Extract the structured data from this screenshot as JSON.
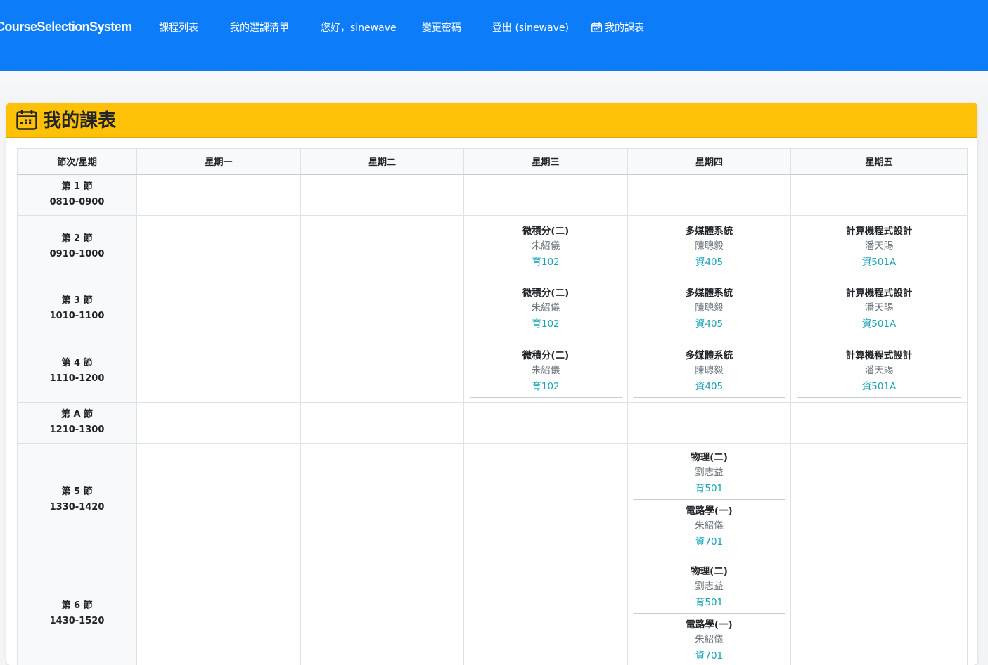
{
  "navbar": {
    "brand": "CourseSelectionSystem",
    "links": [
      "課程列表",
      "我的選課清單",
      "您好，sinewave",
      "變更密碼",
      "登出 (sinewave)",
      "我的課表"
    ]
  },
  "card": {
    "title": "我的課表"
  },
  "table": {
    "headers": [
      "節次/星期",
      "星期一",
      "星期二",
      "星期三",
      "星期四",
      "星期五"
    ],
    "rows": [
      {
        "period": "第 1 節",
        "time": "0810-0900"
      },
      {
        "period": "第 2 節",
        "time": "0910-1000"
      },
      {
        "period": "第 3 節",
        "time": "1010-1100"
      },
      {
        "period": "第 4 節",
        "time": "1110-1200"
      },
      {
        "period": "第 A 節",
        "time": "1210-1300"
      },
      {
        "period": "第 5 節",
        "time": "1330-1420"
      },
      {
        "period": "第 6 節",
        "time": "1430-1520"
      }
    ],
    "courses": {
      "calculus": {
        "name": "微積分(二)",
        "teacher": "朱紹儀",
        "room": "育102"
      },
      "multimedia": {
        "name": "多媒體系統",
        "teacher": "陳聰毅",
        "room": "資405"
      },
      "programming": {
        "name": "計算機程式設計",
        "teacher": "潘天賜",
        "room": "資501A"
      },
      "physics": {
        "name": "物理(二)",
        "teacher": "劉志益",
        "room": "育501"
      },
      "circuits": {
        "name": "電路學(一)",
        "teacher": "朱紹儀",
        "room": "資701"
      }
    }
  },
  "colors": {
    "navbar": "#0d7cf8",
    "card_header": "#ffc107",
    "room_link": "#17a2b8",
    "teacher_text": "#6c757d"
  },
  "icons": {
    "calendar": "calendar-icon"
  }
}
